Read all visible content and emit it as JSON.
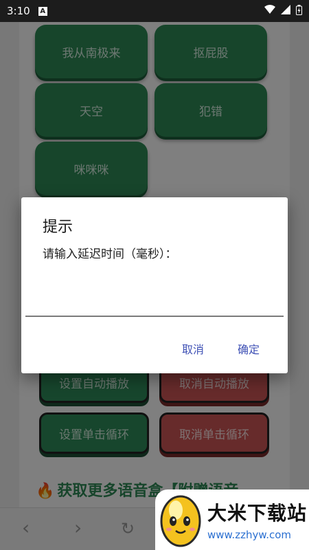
{
  "status_bar": {
    "time": "3:10",
    "notification_icon_letter": "A",
    "icons": [
      "wifi-icon",
      "signal-icon",
      "battery-icon"
    ]
  },
  "sound_buttons": [
    {
      "label": "我从南极来"
    },
    {
      "label": "抠屁股"
    },
    {
      "label": "天空"
    },
    {
      "label": "犯错"
    },
    {
      "label": "咪咪咪"
    }
  ],
  "controls": {
    "set_autoplay": "设置自动播放",
    "cancel_autoplay": "取消自动播放",
    "set_loop": "设置单击循环",
    "cancel_loop": "取消单击循环"
  },
  "promo": {
    "text": "获取更多语音盒【附赠语音"
  },
  "dialog": {
    "title": "提示",
    "message": "请输入延迟时间（毫秒）：",
    "input_value": "",
    "cancel_label": "取消",
    "ok_label": "确定"
  },
  "watermark": {
    "name": "大米下载站",
    "url": "www.zzhyw.com"
  },
  "colors": {
    "green": "#2e8b57",
    "red": "#cf5656",
    "dialog_accent": "#3f51b5"
  }
}
